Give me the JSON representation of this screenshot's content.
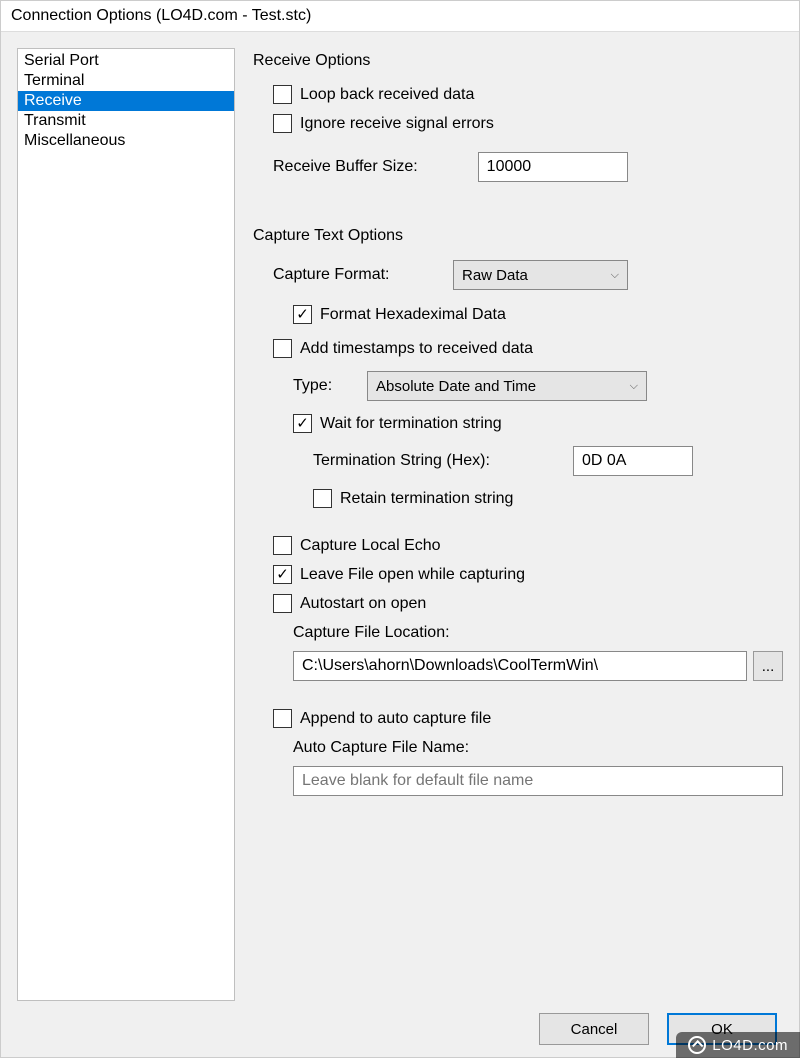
{
  "window": {
    "title": "Connection Options (LO4D.com - Test.stc)"
  },
  "nav": {
    "items": [
      {
        "label": "Serial Port",
        "selected": false
      },
      {
        "label": "Terminal",
        "selected": false
      },
      {
        "label": "Receive",
        "selected": true
      },
      {
        "label": "Transmit",
        "selected": false
      },
      {
        "label": "Miscellaneous",
        "selected": false
      }
    ]
  },
  "receive_options": {
    "heading": "Receive Options",
    "loop_back": {
      "label": "Loop back received data",
      "checked": false
    },
    "ignore_errors": {
      "label": "Ignore receive signal errors",
      "checked": false
    },
    "buffer_label": "Receive Buffer Size:",
    "buffer_value": "10000"
  },
  "capture_options": {
    "heading": "Capture Text Options",
    "format_label": "Capture Format:",
    "format_value": "Raw Data",
    "format_hex": {
      "label": "Format Hexadeximal Data",
      "checked": true
    },
    "add_timestamps": {
      "label": "Add timestamps to received data",
      "checked": false
    },
    "type_label": "Type:",
    "type_value": "Absolute Date and Time",
    "wait_term": {
      "label": "Wait for termination string",
      "checked": true
    },
    "term_label": "Termination String (Hex):",
    "term_value": "0D 0A",
    "retain_term": {
      "label": "Retain termination string",
      "checked": false
    },
    "capture_local_echo": {
      "label": "Capture Local Echo",
      "checked": false
    },
    "leave_open": {
      "label": "Leave File open while capturing",
      "checked": true
    },
    "autostart": {
      "label": "Autostart on open",
      "checked": false
    },
    "capture_loc_label": "Capture File Location:",
    "capture_loc_value": "C:\\Users\\ahorn\\Downloads\\CoolTermWin\\",
    "browse_label": "...",
    "append": {
      "label": "Append to auto capture file",
      "checked": false
    },
    "auto_file_label": "Auto Capture File Name:",
    "auto_file_placeholder": "Leave blank for default file name"
  },
  "footer": {
    "cancel": "Cancel",
    "ok": "OK"
  },
  "watermark": "LO4D.com"
}
